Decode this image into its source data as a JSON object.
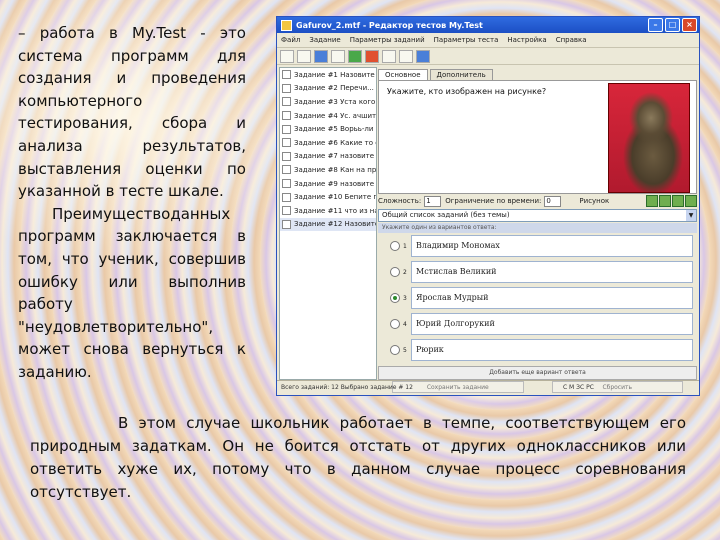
{
  "left_text": {
    "p1": "– работа в My.Test - это система программ для создания и проведения компьютерного тестирования, сбора и анализа результатов, выставления оценки по указанной в тесте шкале.",
    "p2": "Преимуществоданных программ заключается в том, что ученик, совершив ошибку или выполнив работу \"неудовлетворительно\", может снова вернуться к заданию."
  },
  "bottom_text": "В этом случае школьник работает в темпе, соответствующем его природным задаткам. Он не боится отстать от других одноклассников или ответить хуже их, потому что в данном случае процесс соревнования отсутствует.",
  "window": {
    "title": "Gafurov_2.mtf - Редактор тестов My.Test",
    "menu": [
      "Файл",
      "Задание",
      "Параметры заданий",
      "Параметры теста",
      "Настройка",
      "Справка"
    ],
    "tasks": [
      "Задание #1 Назовите год",
      "Задание #2 Перечи... из",
      "Задание #3 Уста кого по",
      "Задание #4 Ус. ачшит в ло",
      "Задание #5 Ворьь-ли сод",
      "Задание #6 Какие то счет",
      "Задание #7 назовите года",
      "Задание #8 Кан на пред",
      "Задание #9 назовите осн",
      "Задание #10 Бепите прив",
      "Задание #11 что из назв",
      "Задание #12 Назовите кто"
    ],
    "tabs": [
      "Основное",
      "Дополнитель"
    ],
    "question": "Укажите, кто изображен на рисунке?",
    "difficulty_label": "Сложность:",
    "difficulty_value": "1",
    "time_label": "Ограничение по времени:",
    "time_value": "0",
    "picture_label": "Рисунок",
    "theme_combo": "Общий список заданий (без темы)",
    "answer_hint": "Укажите один из вариантов ответа:",
    "answers": [
      {
        "num": "1",
        "text": "Владимир Мономах",
        "selected": false
      },
      {
        "num": "2",
        "text": "Мстислав Великий",
        "selected": false
      },
      {
        "num": "3",
        "text": "Ярослав Мудрый",
        "selected": true
      },
      {
        "num": "4",
        "text": "Юрий Долгорукий",
        "selected": false
      },
      {
        "num": "5",
        "text": "Рюрик",
        "selected": false
      }
    ],
    "add_variant": "Добавить еще вариант ответа",
    "save_button": "Сохранить задание",
    "reset_button": "Сбросить",
    "status": "Всего заданий: 12   Выбрано задание # 12",
    "status_caps": "С  М  ЗС  РС"
  }
}
